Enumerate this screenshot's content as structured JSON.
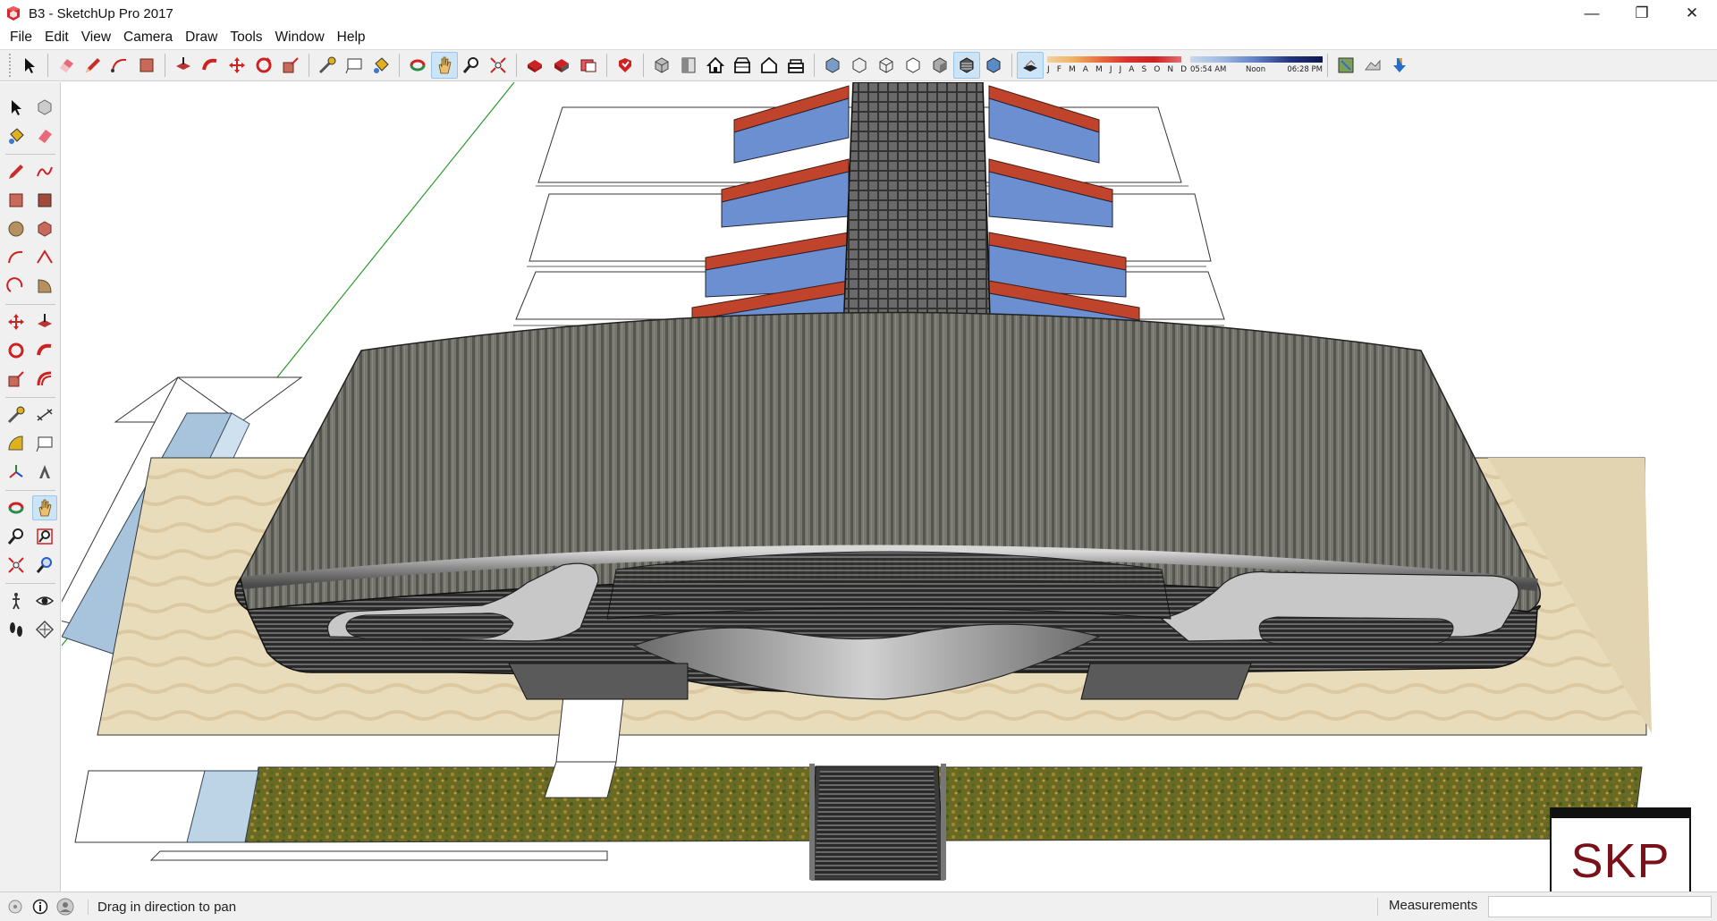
{
  "window": {
    "title": "B3 - SketchUp Pro 2017",
    "controls": {
      "minimize": "—",
      "restore": "❐",
      "close": "✕"
    }
  },
  "menu": [
    "File",
    "Edit",
    "View",
    "Camera",
    "Draw",
    "Tools",
    "Window",
    "Help"
  ],
  "toolbar": {
    "icons": [
      "select-icon",
      "eraser-icon",
      "pencil-icon",
      "arc-icon",
      "rectangle-icon",
      "push-pull-icon",
      "follow-me-icon",
      "move-icon",
      "rotate-icon",
      "scale-icon",
      "tape-measure-icon",
      "text-icon",
      "paint-bucket-icon",
      "orbit-icon",
      "pan-icon",
      "zoom-icon",
      "zoom-extents-icon",
      "3d-warehouse-icon",
      "extension-warehouse-icon",
      "layout-icon",
      "extension-manager-icon",
      "iso-view-icon",
      "top-view-icon",
      "front-view-icon",
      "right-view-icon",
      "back-view-icon",
      "left-view-icon",
      "xray-icon",
      "back-edges-icon",
      "wireframe-icon",
      "hidden-line-icon",
      "shaded-icon",
      "shaded-textures-icon",
      "monochrome-icon",
      "shadows-toggle-icon",
      "add-location-icon",
      "toggle-terrain-icon",
      "photo-textures-icon"
    ],
    "shadow_months": "J F M A M J J A S O N D",
    "shadow_time_start": "05:54 AM",
    "shadow_time_mid": "Noon",
    "shadow_time_end": "06:28 PM",
    "active_tool": "pan-icon"
  },
  "left_toolbar": {
    "active_tool": "pan-tool-icon"
  },
  "status": {
    "hint": "Drag in direction to pan",
    "measurements_label": "Measurements",
    "measurements_value": ""
  },
  "watermark": "SKP",
  "colors": {
    "accent": "#cde4f7",
    "roof": "#6e6e68",
    "ground": "#e8dcbc",
    "grass": "#7a7a2a",
    "stair_red": "#c0442c",
    "glass_blue": "#6b8fd0",
    "skp_red": "#7a1018"
  }
}
